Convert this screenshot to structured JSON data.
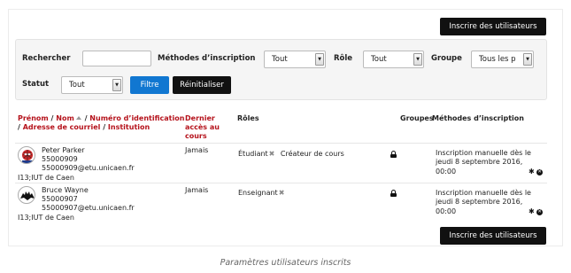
{
  "enrol_users_button": "Inscrire des utilisateurs",
  "filters": {
    "search_label": "Rechercher",
    "search_value": "",
    "methods_label": "Méthodes d’inscription",
    "methods_value": "Tout",
    "role_label": "Rôle",
    "role_value": "Tout",
    "group_label": "Groupe",
    "group_value": "Tous les p",
    "status_label": "Statut",
    "status_value": "Tout",
    "filter_button": "Filtre",
    "reset_button": "Réinitialiser"
  },
  "table": {
    "headers": {
      "firstname": "Prénom",
      "lastname": "Nom",
      "idnumber": "Numéro d’identification",
      "email": "Adresse de courriel",
      "institution": "Institution",
      "last_access_1": "Dernier",
      "last_access_2": "accès au",
      "last_access_3": "cours",
      "roles": "Rôles",
      "groups": "Groupes",
      "methods": "Méthodes d’inscription"
    },
    "rows": [
      {
        "name": "Peter Parker",
        "idnumber": "55000909",
        "email": "55000909@etu.unicaen.fr",
        "institution": "I13;IUT de Caen",
        "last_access": "Jamais",
        "role_1": "Étudiant",
        "role_2": "Créateur de cours",
        "method_1": "Inscription manuelle dès le",
        "method_2": "jeudi 8 septembre 2016,",
        "method_3": "00:00"
      },
      {
        "name": "Bruce Wayne",
        "idnumber": "55000907",
        "email": "55000907@etu.unicaen.fr",
        "institution": "I13;IUT de Caen",
        "last_access": "Jamais",
        "role_1": "Enseignant",
        "method_1": "Inscription manuelle dès le",
        "method_2": "jeudi 8 septembre 2016,",
        "method_3": "00:00"
      }
    ]
  },
  "caption": "Paramètres utilisateurs inscrits",
  "colors": {
    "accent_red": "#b5121b",
    "button_blue": "#1177d1",
    "button_black": "#111111"
  }
}
